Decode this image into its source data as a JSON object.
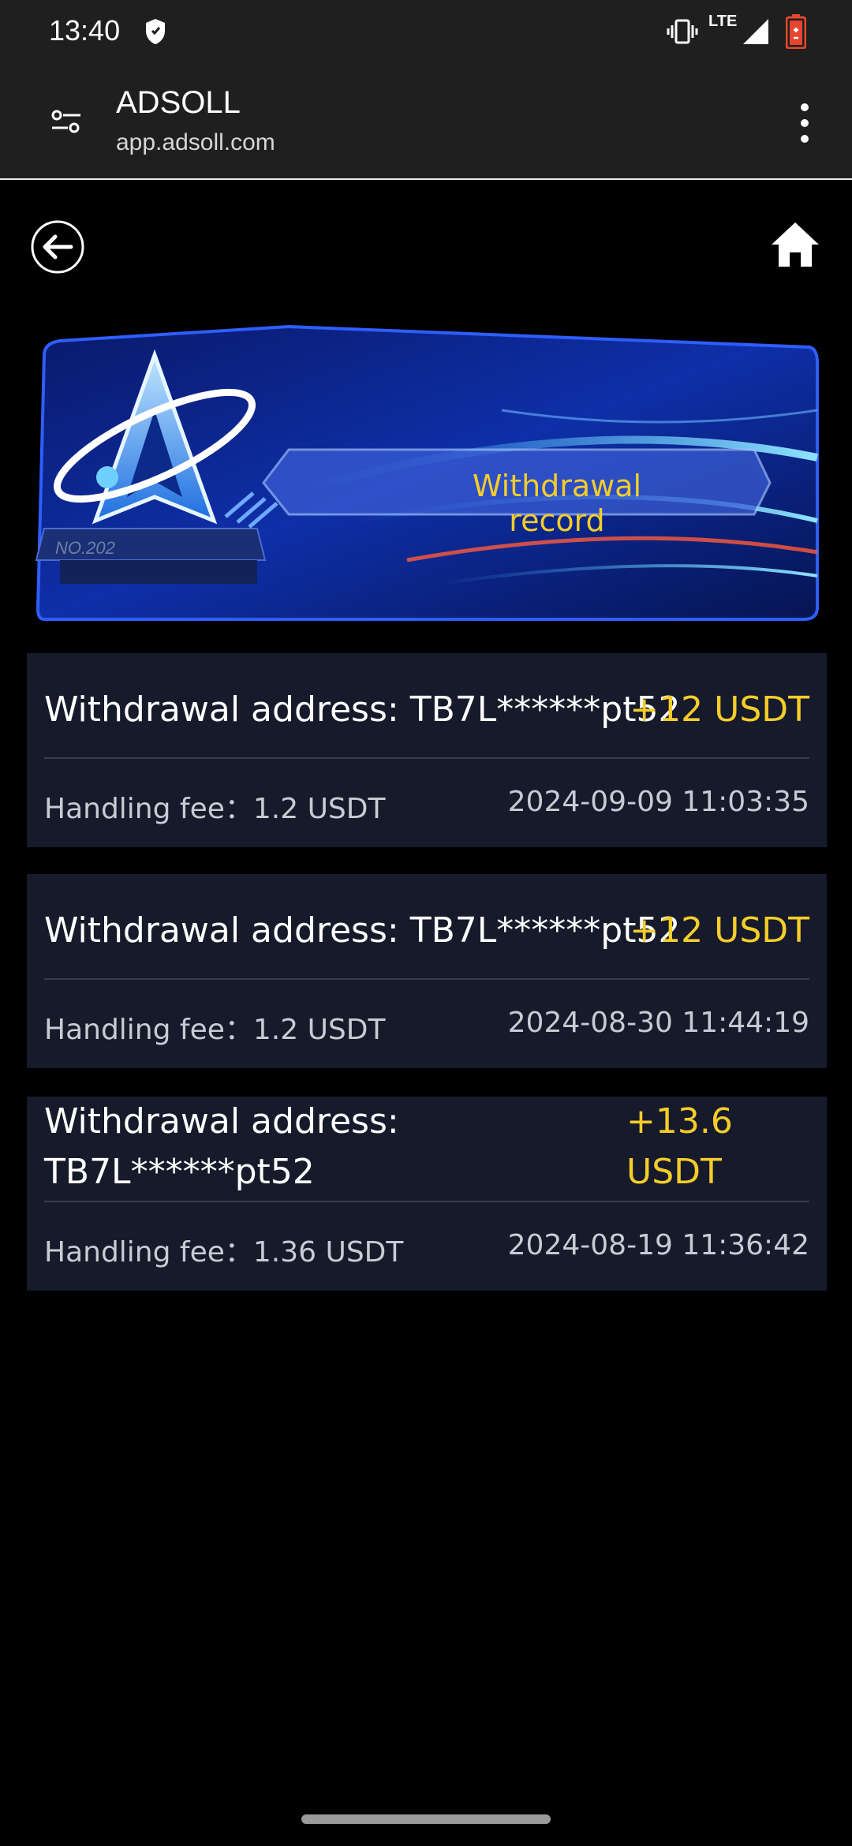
{
  "status_bar": {
    "time": "13:40",
    "network": "LTE",
    "icons": [
      "shield-icon",
      "vibrate-icon",
      "signal-icon",
      "battery-icon"
    ]
  },
  "browser": {
    "title": "ADSOLL",
    "url": "app.adsoll.com",
    "icons": [
      "tune-icon",
      "more-vert-icon"
    ]
  },
  "nav": {
    "icons": [
      "back-arrow-icon",
      "home-icon"
    ]
  },
  "banner": {
    "title": "Withdrawal record",
    "logo_text": "NO.202"
  },
  "records": [
    {
      "address": "Withdrawal address: TB7L******pt52",
      "amount": "+12 USDT",
      "fee": "Handling fee：1.2 USDT",
      "time": "2024-09-09 11:03:35"
    },
    {
      "address": "Withdrawal address: TB7L******pt52",
      "amount": "+12 USDT",
      "fee": "Handling fee：1.2 USDT",
      "time": "2024-08-30 11:44:19"
    },
    {
      "address_line1": "Withdrawal address:",
      "address_line2": "TB7L******pt52",
      "amount_line1": "+13.6",
      "amount_line2": "USDT",
      "fee": "Handling fee：1.36 USDT",
      "time": "2024-08-19 11:36:42"
    }
  ],
  "colors": {
    "accent_gold": "#f4cd2a",
    "card_bg": "#161a2a",
    "page_bg": "#000000"
  }
}
